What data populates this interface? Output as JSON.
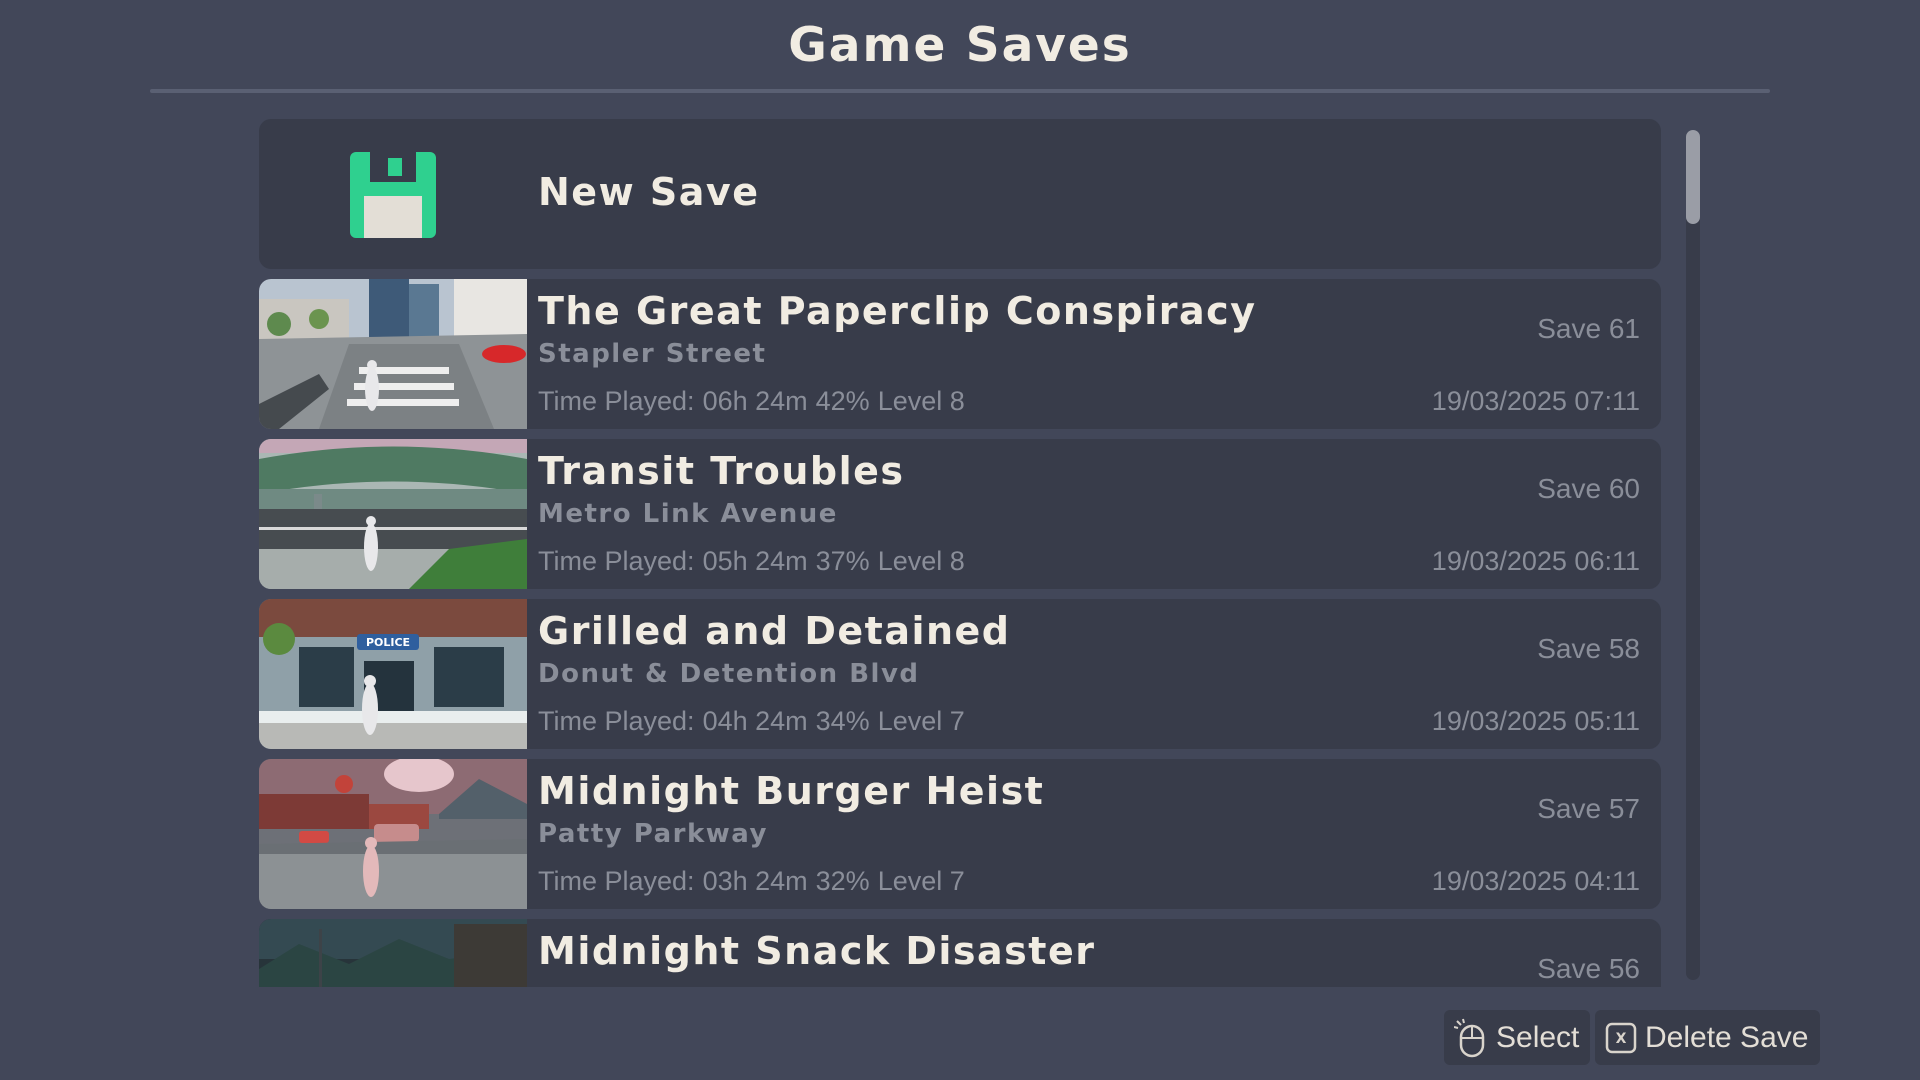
{
  "header": {
    "title": "Game Saves"
  },
  "new_save": {
    "label": "New Save",
    "icon": "floppy-disk-icon",
    "icon_color": "#2fd08f"
  },
  "saves": [
    {
      "title": "The Great Paperclip Conspiracy",
      "location": "Stapler Street",
      "time_label": "Time Played:",
      "time": "06h 24m",
      "progress": "42%",
      "level": "Level 8",
      "save_number": "Save 61",
      "date": "19/03/2025 07:11"
    },
    {
      "title": "Transit Troubles",
      "location": "Metro Link Avenue",
      "time_label": "Time Played:",
      "time": "05h 24m",
      "progress": "37%",
      "level": "Level 8",
      "save_number": "Save 60",
      "date": "19/03/2025 06:11"
    },
    {
      "title": "Grilled and Detained",
      "location": "Donut & Detention Blvd",
      "time_label": "Time Played:",
      "time": "04h 24m",
      "progress": "34%",
      "level": "Level 7",
      "save_number": "Save 58",
      "date": "19/03/2025 05:11",
      "thumb_sign": "POLICE"
    },
    {
      "title": "Midnight Burger Heist",
      "location": "Patty Parkway",
      "time_label": "Time Played:",
      "time": "03h 24m",
      "progress": "32%",
      "level": "Level 7",
      "save_number": "Save 57",
      "date": "19/03/2025 04:11"
    },
    {
      "title": "Midnight Snack Disaster",
      "save_number": "Save 56"
    }
  ],
  "footer": {
    "select_label": "Select",
    "select_icon": "mouse-icon",
    "delete_label": "Delete Save",
    "delete_key": "X",
    "delete_icon": "x-key-icon"
  },
  "scrollbar": {
    "position": 0
  }
}
